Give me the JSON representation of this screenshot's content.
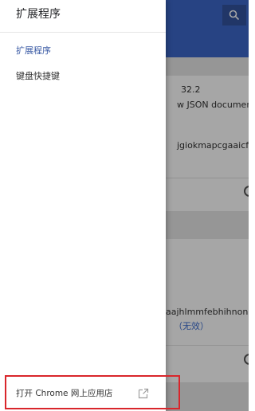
{
  "drawer": {
    "title": "扩展程序",
    "items": [
      {
        "label": "扩展程序",
        "active": true
      },
      {
        "label": "键盘快捷键",
        "active": false
      }
    ],
    "store_link": {
      "label": "打开 Chrome 网上应用店",
      "icon": "open-in-new-icon"
    }
  },
  "background": {
    "header_icon": "search-icon",
    "card1": {
      "version": "32.2",
      "description": "w JSON documents",
      "id": "jgiokmapcgaaicfbcihd"
    },
    "card2": {
      "id": "aajhlmmfebhihnonpkl",
      "status": "（无效）"
    }
  },
  "colors": {
    "header_blue": "#3d67c9",
    "active_item": "#3b5ba5",
    "highlight_red": "#d9262b"
  }
}
